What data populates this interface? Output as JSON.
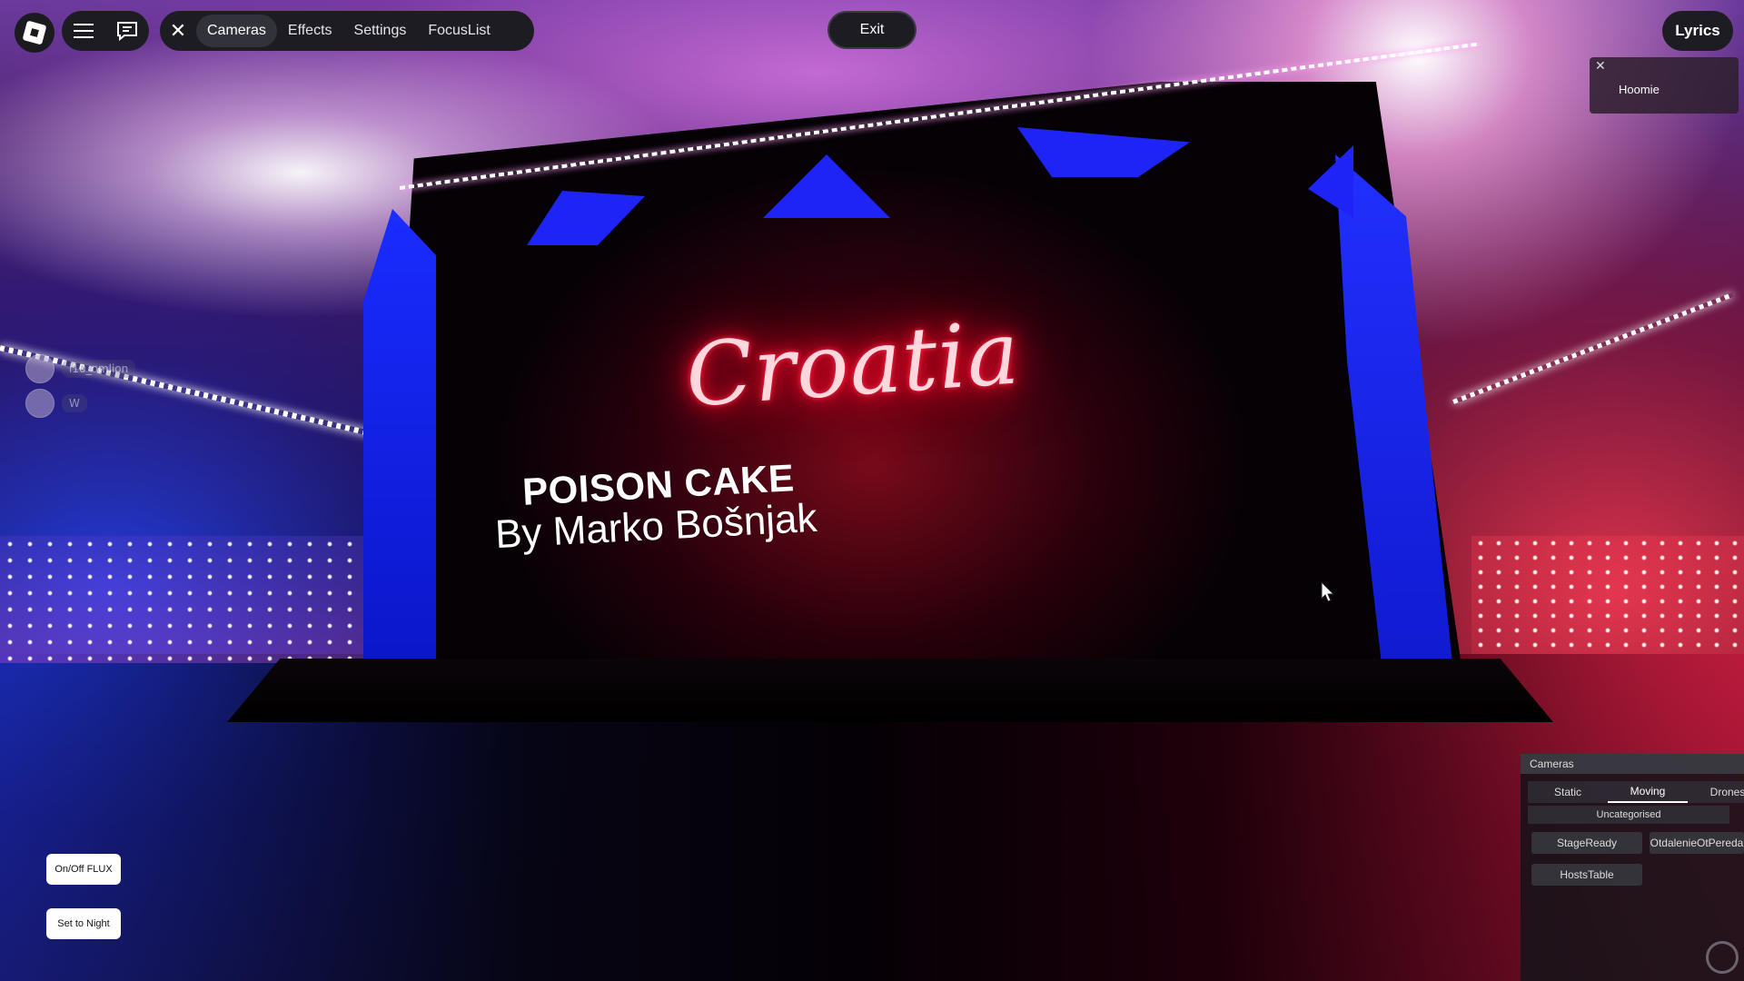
{
  "topbar": {
    "tabs": [
      "Cameras",
      "Effects",
      "Settings",
      "FocusList"
    ],
    "exit_label": "Exit",
    "lyrics_label": "Lyrics"
  },
  "lyrics_popup": {
    "name": "Hoomie"
  },
  "stage": {
    "neon_text": "Croatia",
    "song_title": "POISON CAKE",
    "song_artist": "By Marko Bošnjak"
  },
  "players": [
    {
      "name": "i10_omlion"
    },
    {
      "name": "W"
    }
  ],
  "side_buttons": [
    "On/Off FLUX",
    "Set to Night"
  ],
  "cameras_panel": {
    "title": "Cameras",
    "tabs": [
      "Static",
      "Moving",
      "Drones"
    ],
    "active_tab": "Moving",
    "section": "Uncategorised",
    "items": [
      "StageReady",
      "OtdalenieOtPereda",
      "HostsTable"
    ]
  },
  "icons": {
    "roblox": "roblox-logo-icon",
    "menu": "hamburger-menu-icon",
    "chat": "chat-icon",
    "close": "close-icon"
  },
  "colors": {
    "neon_red": "#ff1030",
    "stage_blue": "#1d24f5",
    "bar_bg": "#1c1c22"
  }
}
